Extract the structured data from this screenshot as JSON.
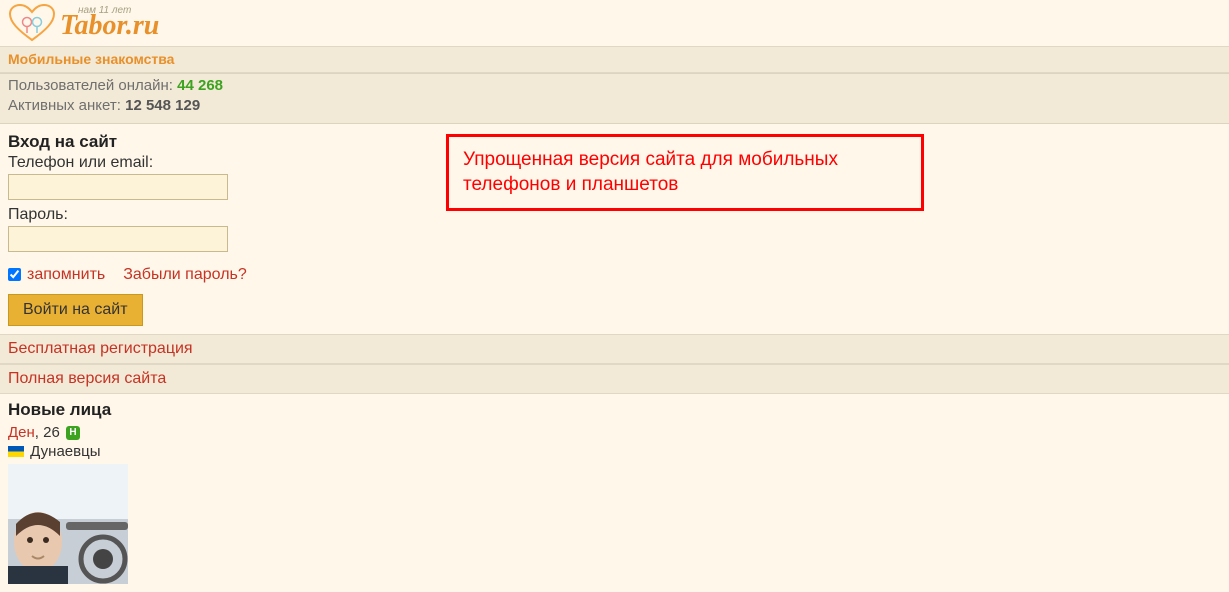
{
  "header": {
    "site_name": "Tabor.ru",
    "tagline": "нам 11 лет"
  },
  "mobile_bar": "Мобильные знакомства",
  "stats": {
    "online_label": "Пользователей онлайн:",
    "online_count": "44 268",
    "profiles_label": "Активных анкет:",
    "profiles_count": "12 548 129"
  },
  "login": {
    "title": "Вход на сайт",
    "login_label": "Телефон или email:",
    "password_label": "Пароль:",
    "remember_label": "запомнить",
    "forgot_label": "Забыли пароль?",
    "submit_label": "Войти на сайт"
  },
  "callout": "Упрощенная версия сайта для мобильных телефонов и планшетов",
  "links": {
    "register": "Бесплатная регистрация",
    "full_version": "Полная версия сайта"
  },
  "new_faces": {
    "title": "Новые лица",
    "profile": {
      "name": "Ден",
      "age": "26",
      "city": "Дунаевцы",
      "online_badge": "Н"
    }
  }
}
